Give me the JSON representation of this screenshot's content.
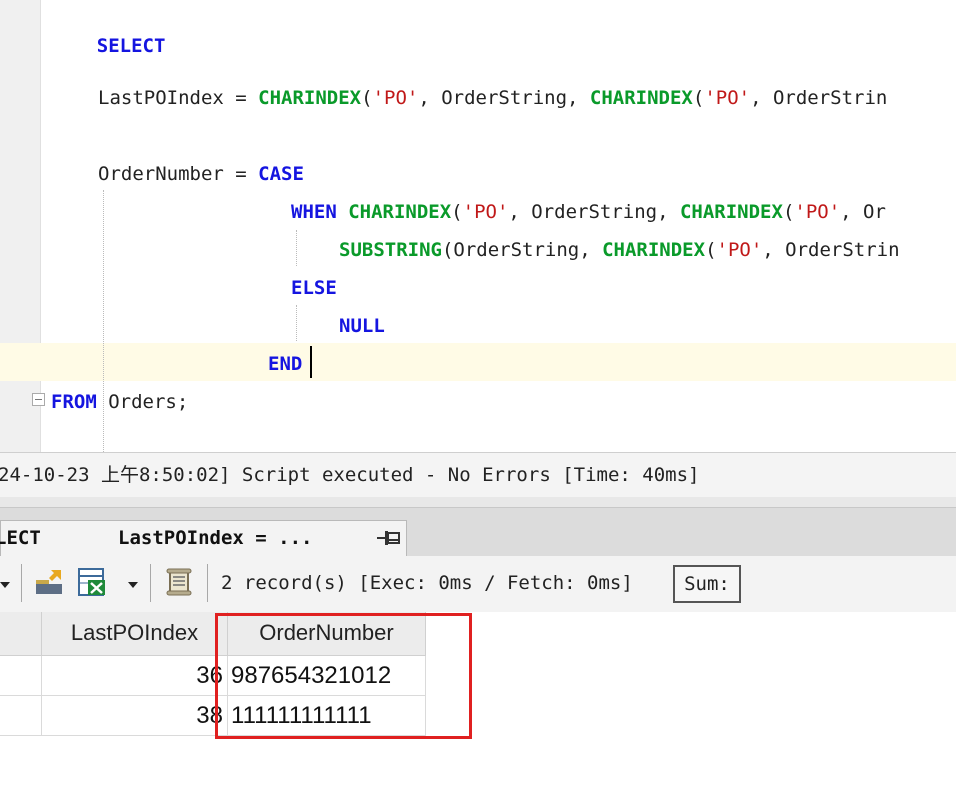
{
  "editor": {
    "lines": [
      {
        "keyword": "SELECT"
      },
      {
        "lhs": "LastPOIndex = ",
        "fn1": "CHARINDEX",
        "s1": "'PO'",
        "mid1": ", OrderString, ",
        "fn2": "CHARINDEX",
        "s2": "'PO'",
        "tail": ", OrderStrin"
      },
      {
        "lhs": "OrderNumber = ",
        "keyword": "CASE"
      },
      {
        "keyword": "WHEN",
        "fn1": "CHARINDEX",
        "s1": "'PO'",
        "mid1": ", OrderString, ",
        "fn2": "CHARINDEX",
        "s2": "'PO'",
        "tail": ", Or"
      },
      {
        "fn1": "SUBSTRING",
        "mid1": "(OrderString, ",
        "fn2": "CHARINDEX",
        "s2": "'PO'",
        "tail": ", OrderStrin"
      },
      {
        "keyword": "ELSE"
      },
      {
        "keyword": "NULL"
      },
      {
        "keyword": "END"
      },
      {
        "keyword": "FROM",
        "tail": " Orders;"
      }
    ]
  },
  "message": "24-10-23 上午8:50:02] Script executed - No Errors [Time: 40ms]",
  "result_tab": {
    "label_left": "LECT",
    "label_main": "LastPOIndex = ..."
  },
  "toolbar": {
    "record_info": "2 record(s) [Exec: 0ms / Fetch: 0ms]",
    "sum_label": "Sum:"
  },
  "grid": {
    "columns": [
      "LastPOIndex",
      "OrderNumber"
    ],
    "rows": [
      {
        "last_po_index": "36",
        "order_number": "987654321012"
      },
      {
        "last_po_index": "38",
        "order_number": "111111111111"
      }
    ]
  },
  "colors": {
    "keyword": "#1515e0",
    "function": "#0a9a2a",
    "string": "#c01818",
    "highlight_box": "#e02020",
    "current_line": "#fffbe6"
  },
  "icons": [
    "pin-icon",
    "dropdown-arrow-icon",
    "export-icon",
    "excel-icon",
    "script-icon"
  ]
}
